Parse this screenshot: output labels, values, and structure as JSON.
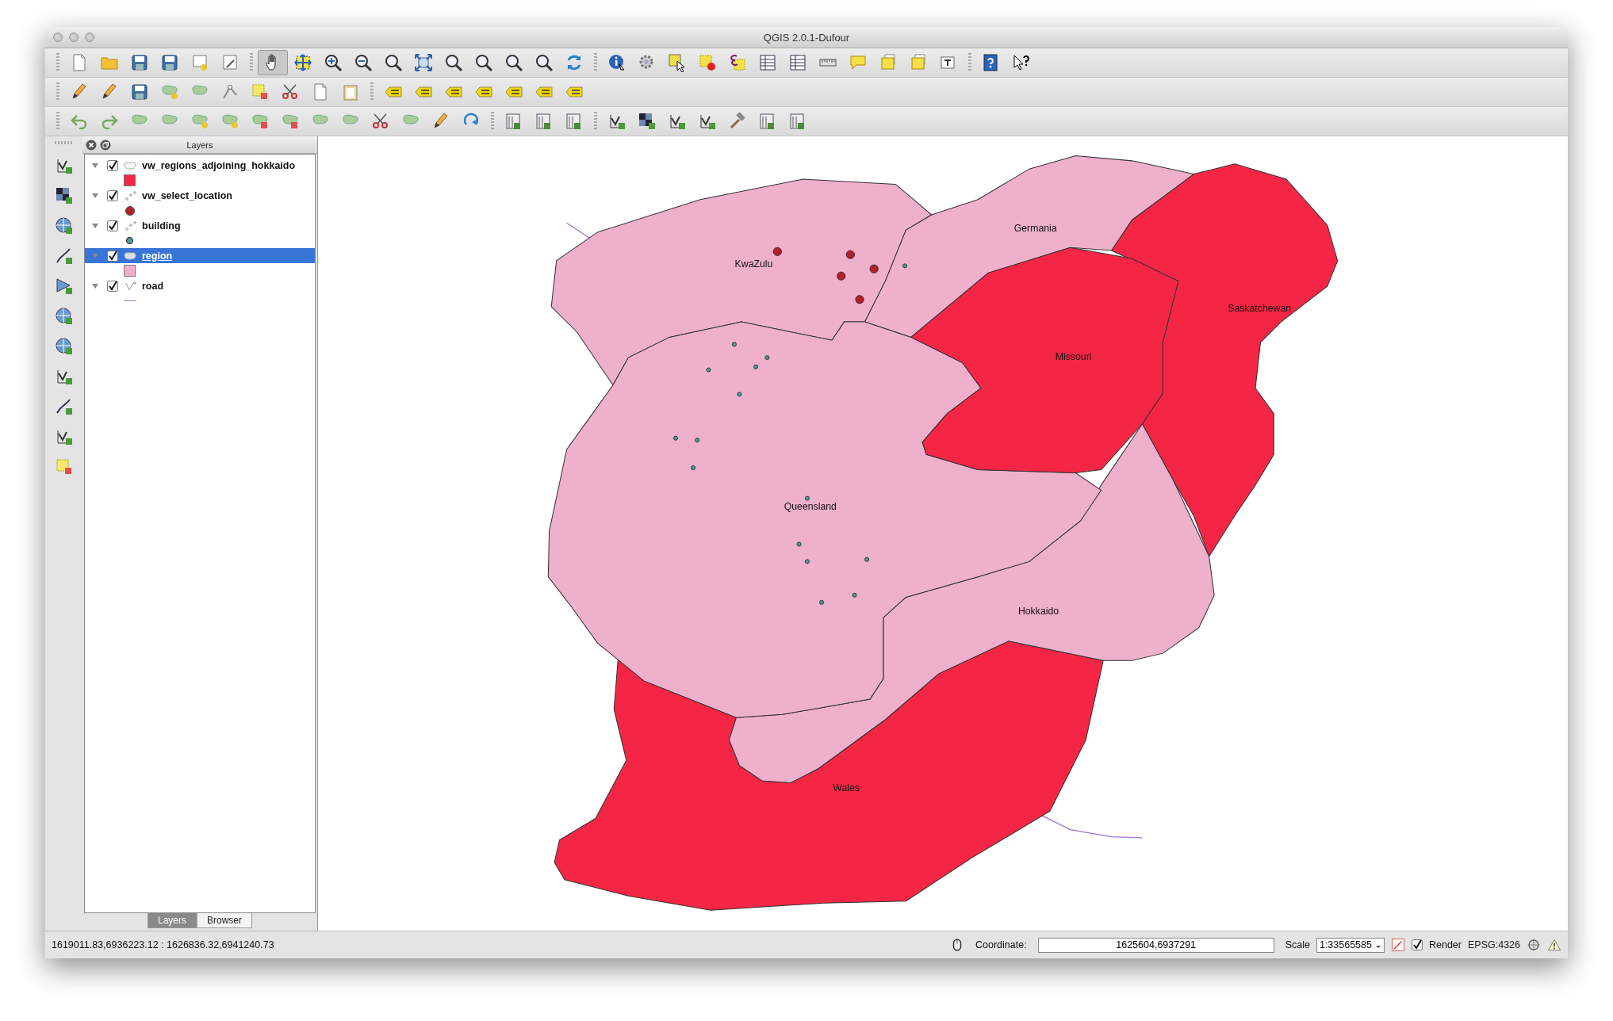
{
  "window": {
    "title": "QGIS 2.0.1-Dufour"
  },
  "toolbar": {
    "pan_tool": {
      "selected": true
    }
  },
  "layers_panel": {
    "title": "Layers",
    "layers": [
      {
        "name": "vw_regions_adjoining_hokkaido",
        "kind": "polygon",
        "checked": true,
        "expanded": true,
        "selected": false,
        "legend": {
          "kind": "square",
          "color": "#f52645"
        }
      },
      {
        "name": "vw_select_location",
        "kind": "point",
        "checked": true,
        "expanded": true,
        "selected": false,
        "legend": {
          "kind": "circle",
          "color": "#b0212a"
        }
      },
      {
        "name": "building",
        "kind": "point",
        "checked": true,
        "expanded": true,
        "selected": false,
        "legend": {
          "kind": "dot",
          "color": "#4a9a9a"
        }
      },
      {
        "name": "region",
        "kind": "polygon",
        "checked": true,
        "expanded": true,
        "selected": true,
        "legend": {
          "kind": "square",
          "color": "#efb0cc"
        }
      },
      {
        "name": "road",
        "kind": "line",
        "checked": true,
        "expanded": true,
        "selected": false,
        "legend": {
          "kind": "line",
          "color": "#a070e0"
        }
      }
    ],
    "tabs": [
      {
        "label": "Layers",
        "selected": true
      },
      {
        "label": "Browser",
        "selected": false
      }
    ]
  },
  "map": {
    "regions": [
      {
        "name": "Wales",
        "color": "#f52645"
      },
      {
        "name": "Saskatchewan",
        "color": "#f52645"
      },
      {
        "name": "KwaZulu",
        "color": "#efb0cc"
      },
      {
        "name": "Germania",
        "color": "#efb0cc"
      },
      {
        "name": "Hokkaido",
        "color": "#efb0cc"
      },
      {
        "name": "Queensland",
        "color": "#efb0cc"
      },
      {
        "name": "Missouri",
        "color": "#f52645"
      }
    ]
  },
  "status_bar": {
    "extent": "1619011.83,6936223.12 : 1626836.32,6941240.73",
    "coordinate_label": "Coordinate:",
    "coordinate": "1625604,6937291",
    "scale_label": "Scale",
    "scale": "1:33565585",
    "render": {
      "label": "Render",
      "checked": true
    },
    "crs": "EPSG:4326"
  }
}
